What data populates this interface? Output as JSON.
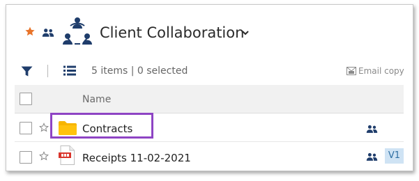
{
  "header": {
    "title": "Client Collaboration",
    "icons": [
      "star-icon",
      "people-icon",
      "collaboration-icon",
      "chevron-down-icon"
    ]
  },
  "toolbar": {
    "items_count": "5 items",
    "separator": "|",
    "selected_count": "0 selected",
    "email_copy_label": "Email copy"
  },
  "table": {
    "columns": [
      "Name"
    ],
    "rows": [
      {
        "name": "Contracts",
        "type_icon": "folder-icon",
        "shared": true,
        "version": ""
      },
      {
        "name": "Receipts 11-02-2021",
        "type_icon": "pdf-file-icon",
        "shared": true,
        "version": "V1"
      }
    ]
  },
  "colors": {
    "accent_star": "#e8742a",
    "icon_navy": "#1f3d6b",
    "folder": "#f7b500",
    "highlight": "#8e44c4",
    "version_badge_bg": "#cfe3f4"
  }
}
